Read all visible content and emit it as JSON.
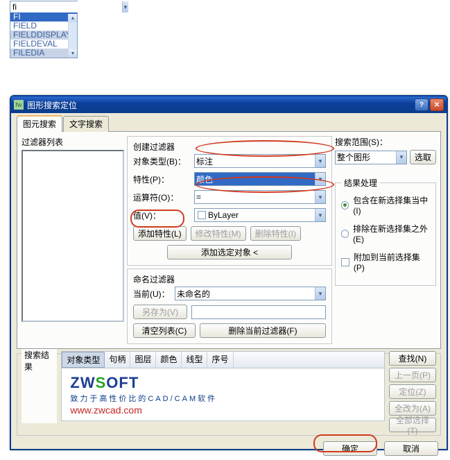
{
  "autocomplete": {
    "input_value": "fi",
    "items": [
      "FI",
      "FIELD",
      "FIELDDISPLAY",
      "FIELDEVAL",
      "FILEDIA"
    ]
  },
  "dialog": {
    "title": "图形搜索定位",
    "titlebar_icon": "fw",
    "tabs": {
      "tab1": "图元搜索",
      "tab2": "文字搜索"
    },
    "left": {
      "filter_list_label": "过滤器列表"
    },
    "create_filter": {
      "heading": "创建过滤器",
      "object_type_label": "对象类型(B)：",
      "object_type_value": "标注",
      "property_label": "特性(P)：",
      "property_value": "颜色",
      "operator_label": "运算符(O)：",
      "operator_value": "=",
      "value_label": "值(V)：",
      "value_value": "ByLayer",
      "add_prop_btn": "添加特性(L)",
      "edit_prop_btn": "修改特性(M)",
      "del_prop_btn": "删除特性(I)",
      "add_selected_btn": "添加选定对象 <"
    },
    "name_filter": {
      "heading": "命名过滤器",
      "current_label": "当前(U)：",
      "current_value": "未命名的",
      "save_as_btn": "另存为(V)",
      "clear_list_btn": "清空列表(C)",
      "del_cur_filter_btn": "删除当前过滤器(F)"
    },
    "search_range": {
      "label": "搜索范围(S)：",
      "value": "整个图形",
      "pick_btn": "选取"
    },
    "result_handle": {
      "legend": "结果处理",
      "include_label": "包含在新选择集当中(I)",
      "exclude_label": "排除在新选择集之外(E)",
      "append_label": "附加到当前选择集(P)"
    },
    "results": {
      "legend": "搜索结果",
      "headers": [
        "对象类型",
        "句柄",
        "图层",
        "颜色",
        "线型",
        "序号"
      ],
      "logo_text_zw": "ZW",
      "logo_text_s": "S",
      "logo_text_oft": "OFT",
      "tagline": "致力于高性价比的CAD/CAM软件",
      "url": "www.zwcad.com",
      "side_btns": {
        "find": "查找(N)",
        "prev": "上一页(P)",
        "locate": "定位(Z)",
        "replace_all": "全改为(A)",
        "select_all": "全部选择(T)"
      }
    },
    "bottom": {
      "ok": "确定",
      "cancel": "取消"
    }
  }
}
